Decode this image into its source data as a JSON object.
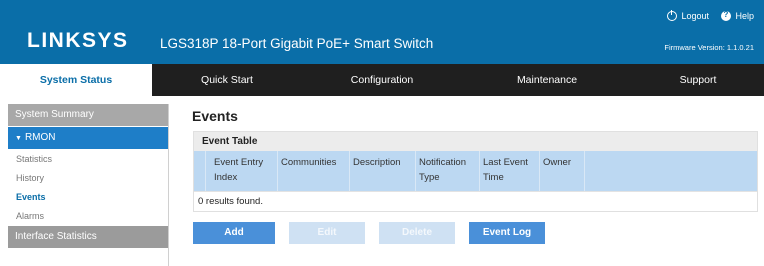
{
  "brand": {
    "logo": "LINKSYS",
    "product": "LGS318P 18-Port Gigabit PoE+ Smart Switch",
    "logout_label": "Logout",
    "help_label": "Help",
    "firmware": "Firmware Version: 1.1.0.21",
    "accent_color": "#0a6ea8"
  },
  "nav": {
    "tabs": [
      {
        "label": "System Status",
        "active": true
      },
      {
        "label": "Quick Start"
      },
      {
        "label": "Configuration"
      },
      {
        "label": "Maintenance"
      },
      {
        "label": "Support"
      }
    ]
  },
  "sidebar": {
    "groups": [
      {
        "label": "System Summary"
      },
      {
        "label": "RMON",
        "expanded": true,
        "active": true,
        "items": [
          "Statistics",
          "History",
          "Events",
          "Alarms"
        ],
        "selected": "Events"
      },
      {
        "label": "Interface Statistics"
      }
    ]
  },
  "main": {
    "title": "Events",
    "table": {
      "caption": "Event Table",
      "columns": [
        "Event Entry Index",
        "Communities",
        "Description",
        "Notification Type",
        "Last Event Time",
        "Owner"
      ],
      "empty_message": "0 results found."
    },
    "buttons": [
      {
        "label": "Add",
        "enabled": true
      },
      {
        "label": "Edit",
        "enabled": false
      },
      {
        "label": "Delete",
        "enabled": false
      },
      {
        "label": "Event Log",
        "enabled": true
      }
    ]
  }
}
